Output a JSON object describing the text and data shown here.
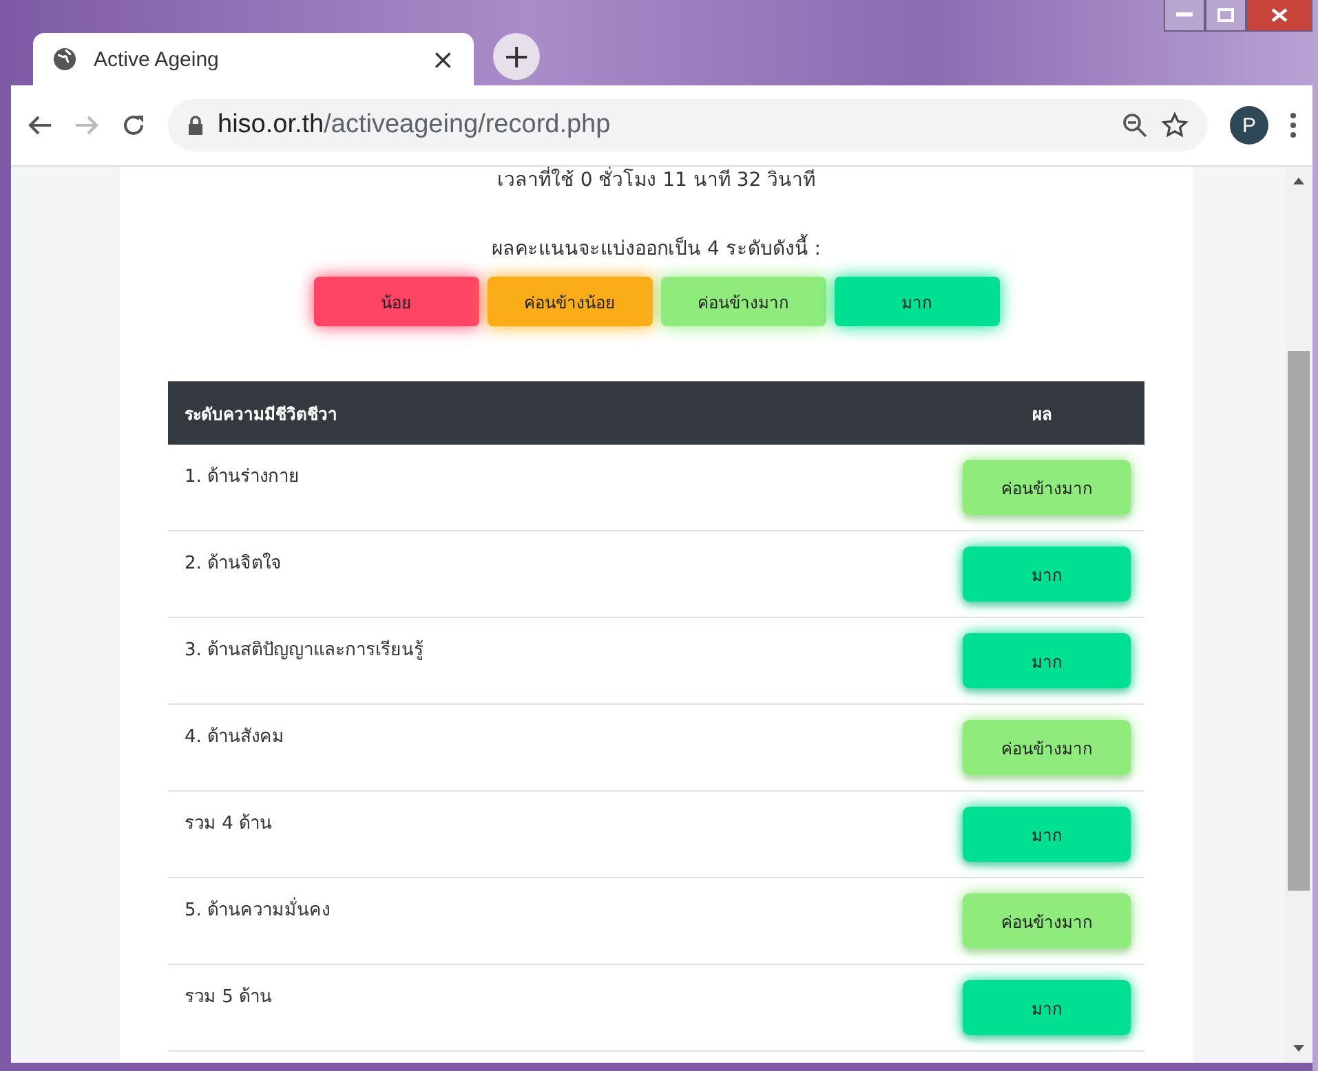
{
  "tab": {
    "title": "Active Ageing",
    "close": "×",
    "new_tab": "+"
  },
  "address": {
    "host": "hiso.or.th",
    "path": "/activeageing/record.php",
    "profile": "P"
  },
  "time_used": "เวลาที่ใช้ 0 ชั่วโมง 11 นาที 32 วินาที",
  "levels_intro": "ผลคะแนนจะแบ่งออกเป็น 4 ระดับดังนี้ :",
  "levels": [
    {
      "label": "น้อย",
      "color": "#ff4466"
    },
    {
      "label": "ค่อนข้างน้อย",
      "color": "#fbad18"
    },
    {
      "label": "ค่อนข้างมาก",
      "color": "#8fec7c"
    },
    {
      "label": "มาก",
      "color": "#00e093"
    }
  ],
  "table": {
    "columns": [
      "ระดับความมีชีวิตชีวา",
      "ผล"
    ],
    "rows": [
      {
        "name": "1. ด้านร่างกาย",
        "result": "ค่อนข้างมาก",
        "color": "#8fec7c"
      },
      {
        "name": "2. ด้านจิตใจ",
        "result": "มาก",
        "color": "#00e093"
      },
      {
        "name": "3. ด้านสติปัญญาและการเรียนรู้",
        "result": "มาก",
        "color": "#00e093"
      },
      {
        "name": "4. ด้านสังคม",
        "result": "ค่อนข้างมาก",
        "color": "#8fec7c"
      },
      {
        "name": "รวม 4 ด้าน",
        "result": "มาก",
        "color": "#00e093"
      },
      {
        "name": "5. ด้านความมั่นคง",
        "result": "ค่อนข้างมาก",
        "color": "#8fec7c"
      },
      {
        "name": "รวม 5 ด้าน",
        "result": "มาก",
        "color": "#00e093"
      }
    ]
  }
}
